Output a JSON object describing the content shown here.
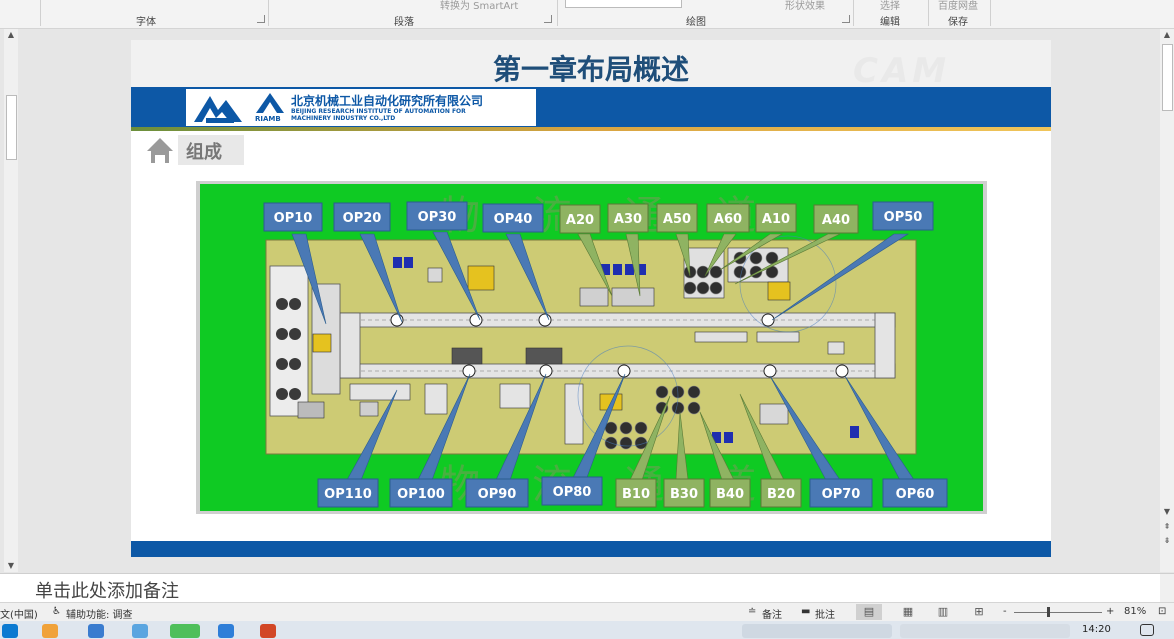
{
  "ribbon": {
    "groups": [
      "字体",
      "段落",
      "绘图",
      "编辑",
      "保存"
    ],
    "cutoff_labels": [
      "转换为 SmartArt",
      "形状效果",
      "选择",
      "百度网盘"
    ]
  },
  "slide": {
    "title": "第一章布局概述",
    "watermark": "CAM",
    "company_cn": "北京机械工业自动化研究所有限公司",
    "company_en_line1": "BEIJING RESEARCH INSTITUTE OF AUTOMATION FOR",
    "company_en_line2": "MACHINERY INDUSTRY CO.,LTD",
    "riamb": "RIAMB",
    "section": "组成",
    "background_text": [
      "物",
      "流",
      "通",
      "道"
    ],
    "station_labels": {
      "top_row": [
        "OP10",
        "OP20",
        "OP30",
        "OP40",
        "A20",
        "A30",
        "A50",
        "A60",
        "A10",
        "A40",
        "OP50"
      ],
      "bottom_row": [
        "OP110",
        "OP100",
        "OP90",
        "OP80",
        "B10",
        "B30",
        "B40",
        "B20",
        "OP70",
        "OP60"
      ]
    }
  },
  "notes": {
    "placeholder": "单击此处添加备注"
  },
  "statusbar": {
    "language": "文(中国)",
    "accessibility": "辅助功能: 调查",
    "notes_button": "备注",
    "comments_button": "批注",
    "zoom_minus": "-",
    "zoom_plus": "+",
    "zoom_level": "81%"
  },
  "taskbar": {
    "time": "14:20"
  },
  "colors": {
    "title_blue": "#1f4e79",
    "band_blue": "#0d58a6",
    "floor_green": "#0fca23",
    "area_khaki": "#cdcb74",
    "op_label": "#4a79b5",
    "ab_label": "#8fb362"
  }
}
